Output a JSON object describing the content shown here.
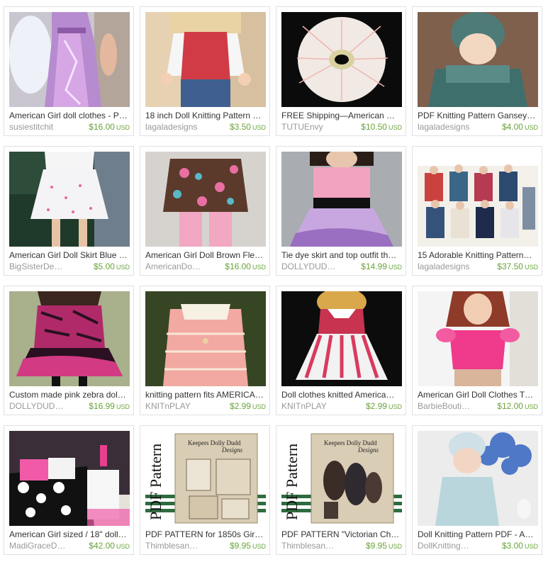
{
  "listings": [
    {
      "title": "American Girl doll clothes - P…",
      "shop": "susiestitchit",
      "price": "$16.00",
      "currency": "USD",
      "image": "doll-pink-sparkle-gown"
    },
    {
      "title": "18 inch Doll Knitting Pattern …",
      "shop": "lagaladesigns",
      "price": "$3.50",
      "currency": "USD",
      "image": "doll-red-knit-vest"
    },
    {
      "title": "FREE Shipping—American …",
      "shop": "TUTUEnvy",
      "price": "$10.50",
      "currency": "USD",
      "image": "white-tutu-skirt"
    },
    {
      "title": "PDF Knitting Pattern Gansey…",
      "shop": "lagaladesigns",
      "price": "$4.00",
      "currency": "USD",
      "image": "doll-green-knit-sweater"
    },
    {
      "title": "American Girl Doll Skirt Blue …",
      "shop": "BigSisterDe…",
      "price": "$5.00",
      "currency": "USD",
      "image": "doll-white-skirt"
    },
    {
      "title": "American Girl Doll Brown Fle…",
      "shop": "AmericanDo…",
      "price": "$16.00",
      "currency": "USD",
      "image": "doll-brown-owl-fleece"
    },
    {
      "title": "Tie dye skirt and top outfit th…",
      "shop": "DOLLYDUD…",
      "price": "$14.99",
      "currency": "USD",
      "image": "doll-pink-tie-dye-outfit"
    },
    {
      "title": "15 Adorable Knitting Pattern…",
      "shop": "lagaladesigns",
      "price": "$37.50",
      "currency": "USD",
      "image": "knitting-pattern-collection"
    },
    {
      "title": "Custom made pink zebra dol…",
      "shop": "DOLLYDUD…",
      "price": "$16.99",
      "currency": "USD",
      "image": "doll-pink-zebra-dress"
    },
    {
      "title": "knitting pattern fits AMERICA…",
      "shop": "KNITnPLAY",
      "price": "$2.99",
      "currency": "USD",
      "image": "doll-pink-knit-jacket"
    },
    {
      "title": "Doll clothes knitted America…",
      "shop": "KNITnPLAY",
      "price": "$2.99",
      "currency": "USD",
      "image": "doll-pink-knit-dress"
    },
    {
      "title": "American Girl Doll Clothes T…",
      "shop": "BarbieBouti…",
      "price": "$12.00",
      "currency": "USD",
      "image": "doll-pink-top"
    },
    {
      "title": "American Girl sized / 18\" doll…",
      "shop": "MadiGraceD…",
      "price": "$42.00",
      "currency": "USD",
      "image": "doll-bed-set"
    },
    {
      "title": "PDF PATTERN for 1850s Gir…",
      "shop": "Thimblesan…",
      "price": "$9.95",
      "currency": "USD",
      "image": "pdf-pattern-1850s"
    },
    {
      "title": "PDF PATTERN \"Victorian Ch…",
      "shop": "Thimblesan…",
      "price": "$9.95",
      "currency": "USD",
      "image": "pdf-pattern-victorian"
    },
    {
      "title": "Doll Knitting Pattern PDF - A…",
      "shop": "DollKnitting…",
      "price": "$3.00",
      "currency": "USD",
      "image": "doll-blue-knit-hydrangea"
    }
  ],
  "pdf_cover": {
    "side_text": "PDF Pattern",
    "brand": "Keepers Dolly Dudd",
    "brand_script": "Designs"
  }
}
